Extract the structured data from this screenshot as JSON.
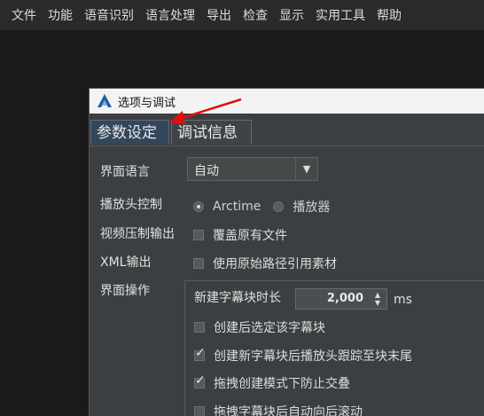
{
  "menu": [
    "文件",
    "功能",
    "语音识别",
    "语言处理",
    "导出",
    "检查",
    "显示",
    "实用工具",
    "帮助"
  ],
  "dialog": {
    "title": "选项与调试",
    "tabs": [
      "参数设定",
      "调试信息"
    ],
    "interface_language": {
      "label": "界面语言",
      "value": "自动"
    },
    "playhead_control": {
      "label": "播放头控制",
      "options": [
        "Arctime",
        "播放器"
      ],
      "selected": "Arctime"
    },
    "video_compress_output": {
      "label": "视频压制输出",
      "checkbox_label": "覆盖原有文件",
      "checked": false
    },
    "xml_output": {
      "label": "XML输出",
      "checkbox_label": "使用原始路径引用素材",
      "checked": false
    },
    "interface_ops": {
      "label": "界面操作",
      "new_block_duration_label": "新建字幕块时长",
      "new_block_duration_value": "2,000",
      "unit": "ms",
      "options": [
        {
          "label": "创建后选定该字幕块",
          "checked": false
        },
        {
          "label": "创建新字幕块后播放头跟踪至块末尾",
          "checked": true
        },
        {
          "label": "拖拽创建模式下防止交叠",
          "checked": true
        },
        {
          "label": "拖拽字幕块后自动向后滚动",
          "checked": false
        }
      ]
    }
  }
}
